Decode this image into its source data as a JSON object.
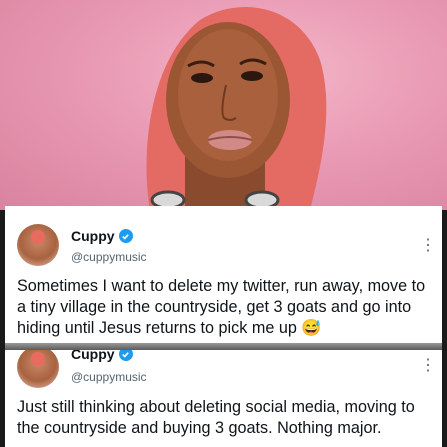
{
  "tweets": [
    {
      "name": "Cuppy",
      "handle": "@cuppymusic",
      "text": "Sometimes I want to delete my twitter, run away, move to a tiny village in the countryside, get 3 goats and go into hiding until Jesus returns to pick me up 😅",
      "verified": true
    },
    {
      "name": "Cuppy",
      "handle": "@cuppymusic",
      "text": "Just still thinking about deleting social media, moving to the countryside and buying 3 goats. Nothing major.",
      "verified": true
    }
  ],
  "icons": {
    "verified": "verified-badge-icon",
    "more": "more-options-icon"
  },
  "colors": {
    "photo_background": "#e99ab4",
    "verified_blue": "#1d9bf0",
    "text": "#0f1419",
    "secondary_text": "#536471"
  }
}
